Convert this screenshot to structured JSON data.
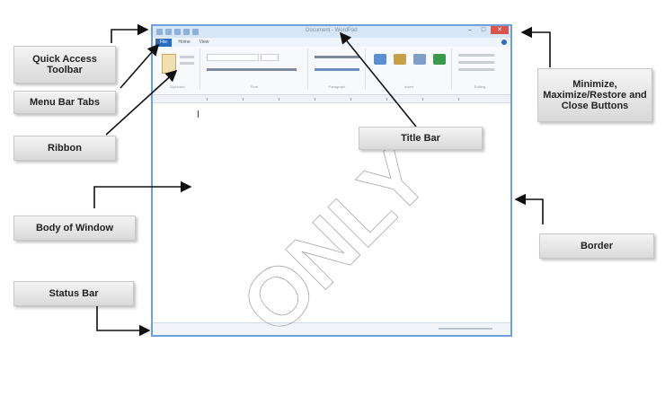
{
  "window": {
    "title": "Document - WordPad",
    "tabs": [
      "File",
      "Home",
      "View"
    ],
    "ribbon_groups": [
      "Clipboard",
      "Font",
      "Paragraph",
      "Insert",
      "Editing"
    ]
  },
  "callouts": {
    "quick_access_toolbar": "Quick Access Toolbar",
    "menu_bar_tabs": "Menu Bar Tabs",
    "ribbon": "Ribbon",
    "body_of_window": "Body of Window",
    "status_bar": "Status Bar",
    "title_bar": "Title Bar",
    "window_buttons": "Minimize, Maximize/Restore and Close Buttons",
    "border": "Border"
  },
  "watermark": {
    "text": "ONLY"
  },
  "colors": {
    "border_blue": "#6fa0d8",
    "file_tab": "#2b6cc4",
    "close_button": "#d9534f"
  }
}
